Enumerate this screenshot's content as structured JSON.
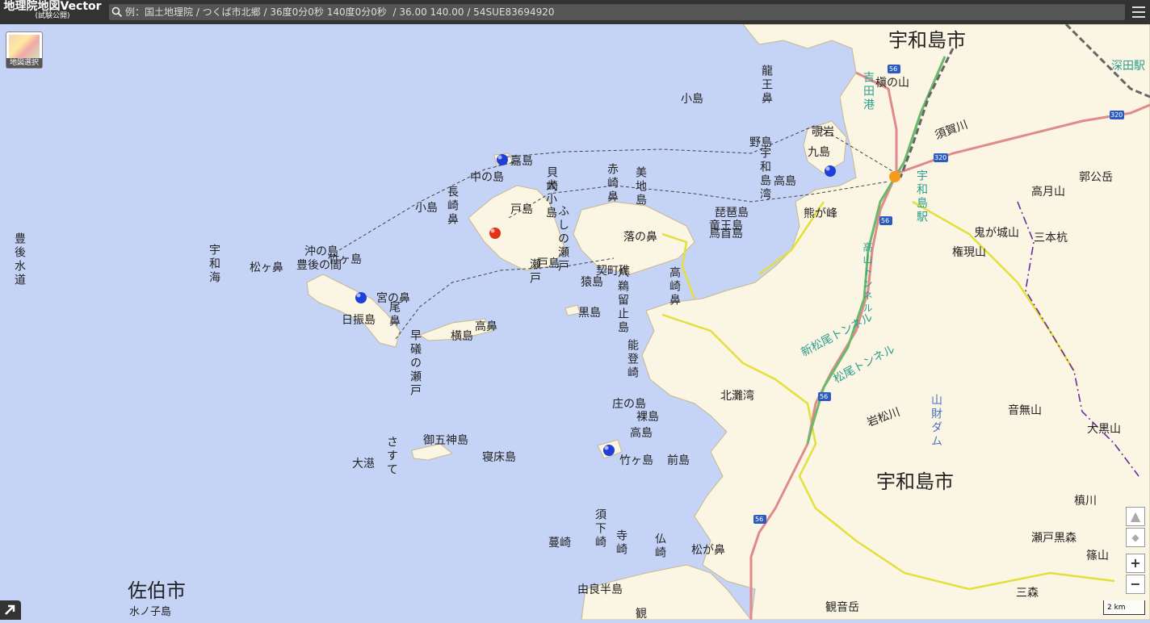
{
  "app": {
    "title": "地理院地図Vector",
    "subtitle": "(試験公開)"
  },
  "search": {
    "placeholder": "例：国土地理院 / つくば市北郷 / 36度0分0秒 140度0分0秒  / 36.00 140.00 / 54SUE83694920"
  },
  "layer_button": {
    "label": "地図選択"
  },
  "scale": {
    "label": "2 km"
  },
  "map": {
    "cities": {
      "uwajima_n": "宇和島市",
      "uwajima_s": "宇和島市",
      "saiki": "佐伯市"
    },
    "water": {
      "bungo": "豊後水道",
      "uwakai": "宇和海",
      "kitanadawan": "北灘湾"
    },
    "stations": {
      "fukada": "深田駅",
      "uwajima": "宇和島駅"
    },
    "roads": {
      "r56a": "56",
      "r56b": "56",
      "r56c": "56",
      "r56d": "56",
      "r320a": "320",
      "r320b": "320"
    },
    "tunnels": {
      "shinmatsuo": "新松尾トンネル",
      "matsuo": "松尾トンネル",
      "koyama": "高山トンネル"
    },
    "rivers": {
      "suga": "須賀川",
      "iwamatsu": "岩松川",
      "yamazai": "山財ダム"
    },
    "mountains": {
      "kounoyama": "槇の山",
      "koukouzan": "郭公岳",
      "takatsuki": "高月山",
      "onigajo": "鬼が城山",
      "sanbon": "三本杭",
      "gongen": "権現山",
      "otonashi": "音無山",
      "ookuro": "大黒山",
      "yokokawa": "槙川",
      "setokuro": "瀬戸黒森",
      "sasayama": "篠山",
      "sanmori": "三森",
      "kannon": "観音岳",
      "kumagamine": "熊が峰"
    },
    "places": {
      "ryuo": "龍王鼻",
      "kojima": "小島",
      "nojima": "野島",
      "uwajimawan": "宇和島湾",
      "nakajima_l": "高島",
      "kujima": "九島",
      "shiiwa": "覗岩",
      "yoshidako": "吉田港",
      "kashima": "嘉島",
      "naka": "中の島",
      "kaizaki": "貝崎",
      "ookojima": "大小島",
      "fushi": "ふしの瀬戸",
      "akasaki": "赤崎鼻",
      "mijijima": "美地島",
      "biwa": "琵琶島",
      "ryuoujima": "竜王島",
      "torijima": "鳥首島",
      "nagasaki": "長崎鼻",
      "kojima2": "小島",
      "tojima": "戸島",
      "ochi": "落の鼻",
      "shiuemachi": "契町礁",
      "okinoshima": "沖の島",
      "takegashima": "竹ヶ島",
      "bungonoma": "豊後の間",
      "matsugahana": "松ヶ鼻",
      "seto2": "瀬戸",
      "tojima2": "戸島",
      "sarujima": "猿島",
      "hachiwashi": "八鵜留止島",
      "takasakihana": "高崎鼻",
      "miyanohana": "宮の鼻",
      "obi": "尾鼻",
      "hiburi": "日振島",
      "kurojima": "黒島",
      "takahana": "高鼻",
      "yokojima": "横島",
      "hayaiso": "早礒の瀬戸",
      "noto": "能登崎",
      "shonoshima": "庄の島",
      "hadakajima": "裸島",
      "takashima": "高島",
      "gogoshinjima": "御五神島",
      "nedoko": "寝床島",
      "osuri": "大濨",
      "sasute": "さすて",
      "takegashima2": "竹ヶ島",
      "maejima": "前島",
      "sushita": "須下崎",
      "terasaki": "寺崎",
      "hotoke": "仏崎",
      "matsugahana2": "松が鼻",
      "kazurasaki": "蔓崎",
      "yurahanto": "由良半島",
      "kan": "観",
      "mizunoko": "水ノ子島"
    }
  }
}
